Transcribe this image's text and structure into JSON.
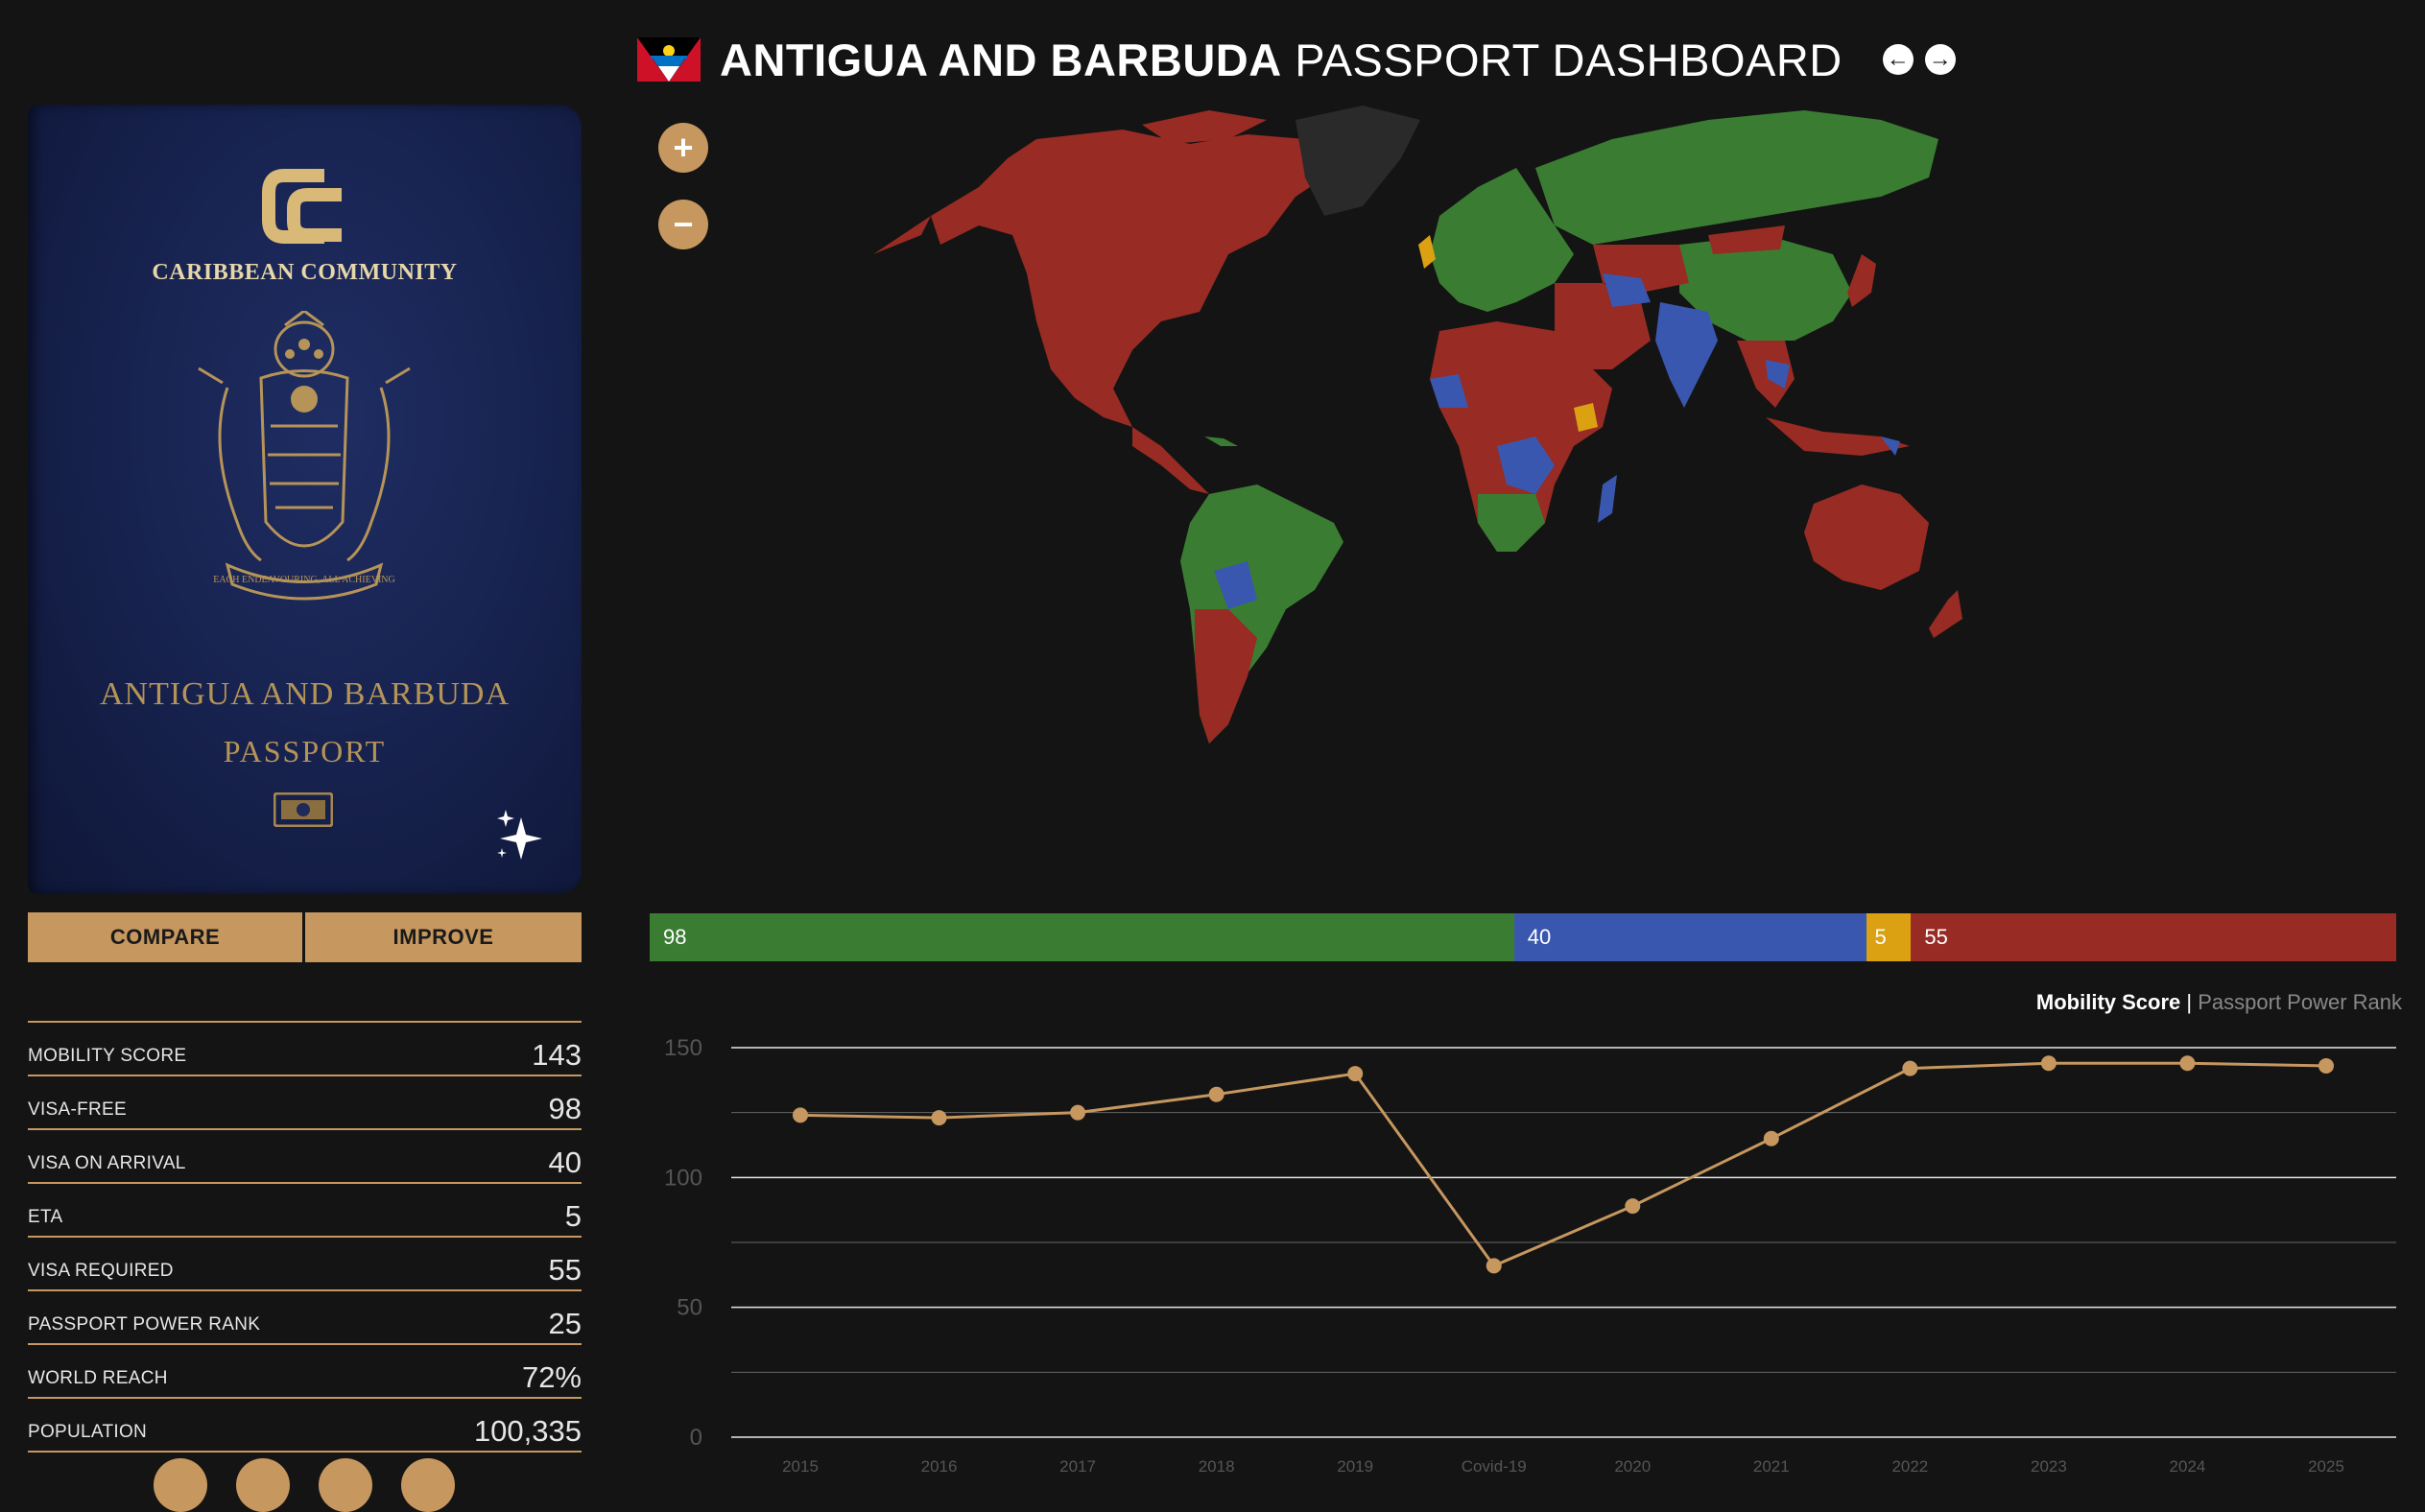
{
  "header": {
    "title_bold": "ANTIGUA AND BARBUDA",
    "title_light": "PASSPORT DASHBOARD",
    "prev_icon": "arrow-left-icon",
    "next_icon": "arrow-right-icon"
  },
  "passport": {
    "logo_text": "CC",
    "community": "CARIBBEAN COMMUNITY",
    "motto": "EACH ENDEAVOURING, ALL ACHIEVING",
    "country": "ANTIGUA AND BARBUDA",
    "doc": "PASSPORT"
  },
  "actions": {
    "compare": "COMPARE",
    "improve": "IMPROVE"
  },
  "stats": [
    {
      "label": "MOBILITY SCORE",
      "value": "143"
    },
    {
      "label": "VISA-FREE",
      "value": "98"
    },
    {
      "label": "VISA ON ARRIVAL",
      "value": "40"
    },
    {
      "label": "ETA",
      "value": "5"
    },
    {
      "label": "VISA REQUIRED",
      "value": "55"
    },
    {
      "label": "PASSPORT POWER RANK",
      "value": "25"
    },
    {
      "label": "WORLD REACH",
      "value": "72%"
    },
    {
      "label": "POPULATION",
      "value": "100,335"
    }
  ],
  "zoom": {
    "in": "+",
    "out": "−"
  },
  "colors": {
    "visa_free": "#3a7d32",
    "visa_on_arrival": "#3a57b0",
    "eta": "#dba112",
    "visa_required": "#982b23",
    "own_country": "#2a2a2a",
    "accent": "#c6975f"
  },
  "breakdown": [
    {
      "key": "visa_free",
      "value": 98
    },
    {
      "key": "visa_on_arrival",
      "value": 40
    },
    {
      "key": "eta",
      "value": 5
    },
    {
      "key": "visa_required",
      "value": 55
    }
  ],
  "chart_toggle": {
    "active": "Mobility Score",
    "separator": "|",
    "inactive": "Passport Power Rank"
  },
  "chart_data": {
    "type": "line",
    "title": "",
    "xlabel": "",
    "ylabel": "",
    "categories": [
      "2015",
      "2016",
      "2017",
      "2018",
      "2019",
      "Covid-19",
      "2020",
      "2021",
      "2022",
      "2023",
      "2024",
      "2025"
    ],
    "series": [
      {
        "name": "Mobility Score",
        "values": [
          124,
          123,
          125,
          132,
          140,
          66,
          89,
          115,
          142,
          144,
          144,
          143
        ]
      }
    ],
    "ylim": [
      0,
      150
    ],
    "yticks": [
      0,
      50,
      100,
      150
    ],
    "grid": true
  }
}
